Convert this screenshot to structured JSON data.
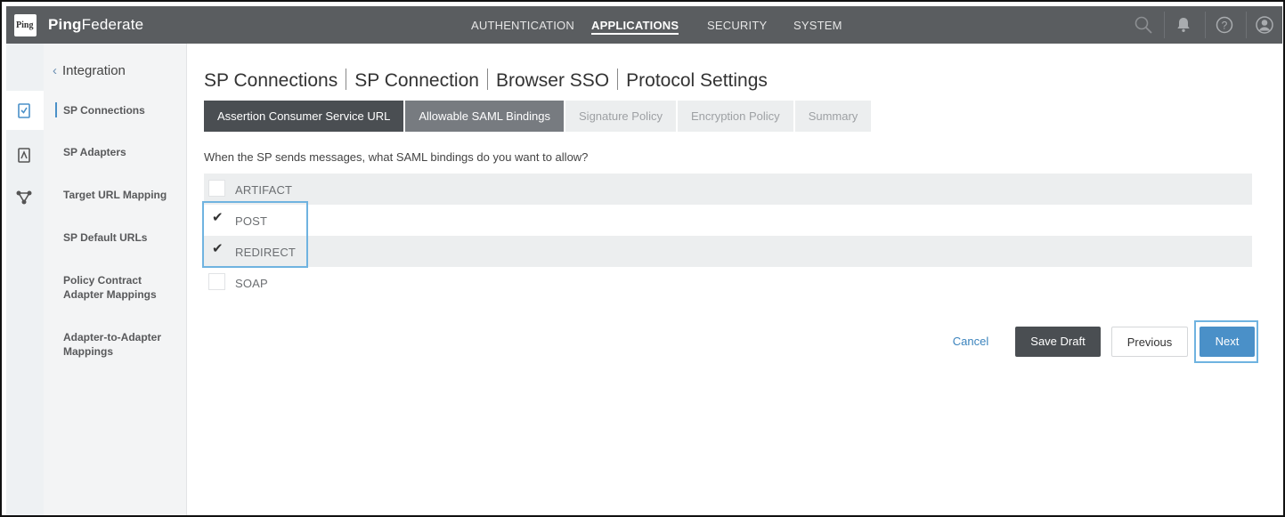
{
  "topbar": {
    "logo_text": "Ping",
    "brand_bold": "Ping",
    "brand_rest": "Federate",
    "nav": [
      "AUTHENTICATION",
      "APPLICATIONS",
      "SECURITY",
      "SYSTEM"
    ],
    "active_nav": "APPLICATIONS",
    "icons": [
      "search-icon",
      "bell-icon",
      "help-icon",
      "user-icon"
    ]
  },
  "rail": {
    "icons": [
      "sp-connections-icon",
      "sp-adapters-icon",
      "target-url-mapping-icon"
    ]
  },
  "sidebar": {
    "back_label": "Integration",
    "items": [
      "SP Connections",
      "SP Adapters",
      "Target URL Mapping",
      "SP Default URLs",
      "Policy Contract Adapter Mappings",
      "Adapter-to-Adapter Mappings"
    ],
    "active_item": "SP Connections"
  },
  "breadcrumb": [
    "SP Connections",
    "SP Connection",
    "Browser SSO",
    "Protocol Settings"
  ],
  "tabs": [
    {
      "label": "Assertion Consumer Service URL",
      "state": "done"
    },
    {
      "label": "Allowable SAML Bindings",
      "state": "current"
    },
    {
      "label": "Signature Policy",
      "state": "pending"
    },
    {
      "label": "Encryption Policy",
      "state": "pending"
    },
    {
      "label": "Summary",
      "state": "pending"
    }
  ],
  "question": "When the SP sends messages, what SAML bindings do you want to allow?",
  "bindings": [
    {
      "label": "ARTIFACT",
      "checked": false
    },
    {
      "label": "POST",
      "checked": true
    },
    {
      "label": "REDIRECT",
      "checked": true
    },
    {
      "label": "SOAP",
      "checked": false
    }
  ],
  "buttons": {
    "cancel": "Cancel",
    "save_draft": "Save Draft",
    "previous": "Previous",
    "next": "Next"
  },
  "colors": {
    "topbar": "#5a5d60",
    "accent": "#4a90c8",
    "highlight": "#6fb3e0",
    "dark_button": "#4a4e52"
  }
}
